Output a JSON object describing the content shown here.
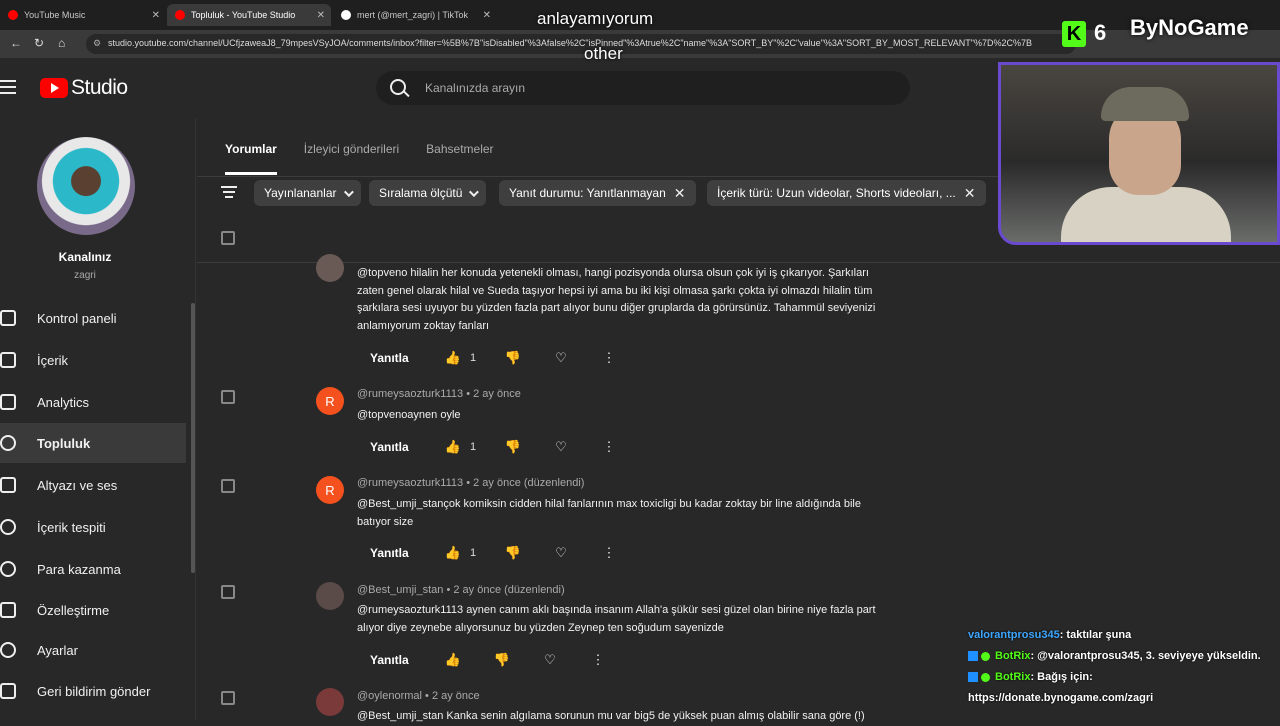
{
  "browser": {
    "tabs": [
      {
        "title": "YouTube Music",
        "color": "#ff0000"
      },
      {
        "title": "Topluluk - YouTube Studio",
        "color": "#ff0000"
      },
      {
        "title": "mert (@mert_zagri) | TikTok",
        "color": "#ffffff"
      }
    ],
    "url": "studio.youtube.com/channel/UCfjzaweaJ8_79mpesVSyJOA/comments/inbox?filter=%5B%7B\"isDisabled\"%3Afalse%2C\"isPinned\"%3Atrue%2C\"name\"%3A\"SORT_BY\"%2C\"value\"%3A\"SORT_BY_MOST_RELEVANT\"%7D%2C%7B"
  },
  "overlay": {
    "caption_top": "anlayamıyorum",
    "caption_bottom": "other",
    "kick_count": "6",
    "brand": "ByNoGame"
  },
  "header": {
    "logo_text": "Studio",
    "search_placeholder": "Kanalınızda arayın"
  },
  "sidebar": {
    "channel_name": "Kanalınız",
    "channel_handle": "zagri",
    "items": [
      {
        "label": "Kontrol paneli",
        "icon": "dashboard-icon"
      },
      {
        "label": "İçerik",
        "icon": "content-icon"
      },
      {
        "label": "Analytics",
        "icon": "analytics-icon"
      },
      {
        "label": "Topluluk",
        "icon": "community-icon"
      },
      {
        "label": "Altyazı ve ses",
        "icon": "subtitles-icon"
      },
      {
        "label": "İçerik tespiti",
        "icon": "copyright-icon"
      },
      {
        "label": "Para kazanma",
        "icon": "money-icon"
      },
      {
        "label": "Özelleştirme",
        "icon": "customization-icon"
      },
      {
        "label": "Ayarlar",
        "icon": "gear-icon"
      },
      {
        "label": "Geri bildirim gönder",
        "icon": "feedback-icon"
      }
    ]
  },
  "main": {
    "tabs": [
      "Yorumlar",
      "İzleyici gönderileri",
      "Bahsetmeler"
    ],
    "filters": [
      {
        "label": "Yayınlananlar"
      },
      {
        "label": "Sıralama ölçütü"
      },
      {
        "label": "Yanıt durumu: Yanıtlanmayan"
      },
      {
        "label": "İçerik türü: Uzun videolar, Shorts videoları, ..."
      }
    ],
    "reply_label": "Yanıtla",
    "comments": [
      {
        "author": "",
        "time": "",
        "text": "@topveno hilalin her konuda yetenekli olması, hangi pozisyonda olursa olsun çok iyi iş çıkarıyor. Şarkıları zaten genel olarak hilal ve Sueda taşıyor hepsi iyi ama bu iki kişi olmasa şarkı çokta iyi olmazdı hilalin tüm şarkılara sesi uyuyor bu yüzden fazla part alıyor bunu diğer gruplarda da görürsünüz. Tahammül seviyenizi anlamıyorum zoktay fanları",
        "likes": "1",
        "avatar_letter": "",
        "avatar_color": "#6a5a55"
      },
      {
        "author": "@rumeysaozturk1113",
        "time": "2 ay önce",
        "text": "@topvenoaynen oyle",
        "likes": "1",
        "avatar_letter": "R",
        "avatar_color": "#f4511e"
      },
      {
        "author": "@rumeysaozturk1113",
        "time": "2 ay önce (düzenlendi)",
        "text": "@Best_umji_stançok komiksin cidden hilal fanlarının max toxicligi bu kadar zoktay bir line aldığında bile batıyor size",
        "likes": "1",
        "avatar_letter": "R",
        "avatar_color": "#f4511e"
      },
      {
        "author": "@Best_umji_stan",
        "time": "2 ay önce (düzenlendi)",
        "text": "@rumeysaozturk1113 aynen canım aklı başında insanım Allah'a şükür sesi güzel olan birine niye fazla part alıyor diye zeynebe alıyorsunuz bu yüzden Zeynep ten soğudum sayenizde",
        "likes": "",
        "avatar_letter": "",
        "avatar_color": "#5a4a48"
      },
      {
        "author": "@oylenormal",
        "time": "2 ay önce",
        "text": "@Best_umji_stan Kanka senin algılama sorunun mu var big5 de yüksek puan almış olabilir sana göre (!)",
        "likes": "",
        "avatar_letter": "",
        "avatar_color": "#7a3a3a"
      }
    ]
  },
  "chat": [
    {
      "user": "valorantprosu345",
      "message": ": taktılar şuna"
    },
    {
      "user": "BotRix",
      "message": ": @valorantprosu345, 3. seviyeye yükseldin."
    },
    {
      "user": "BotRix",
      "message": ": Bağış için:"
    },
    {
      "user": "",
      "message": "https://donate.bynogame.com/zagri"
    }
  ]
}
